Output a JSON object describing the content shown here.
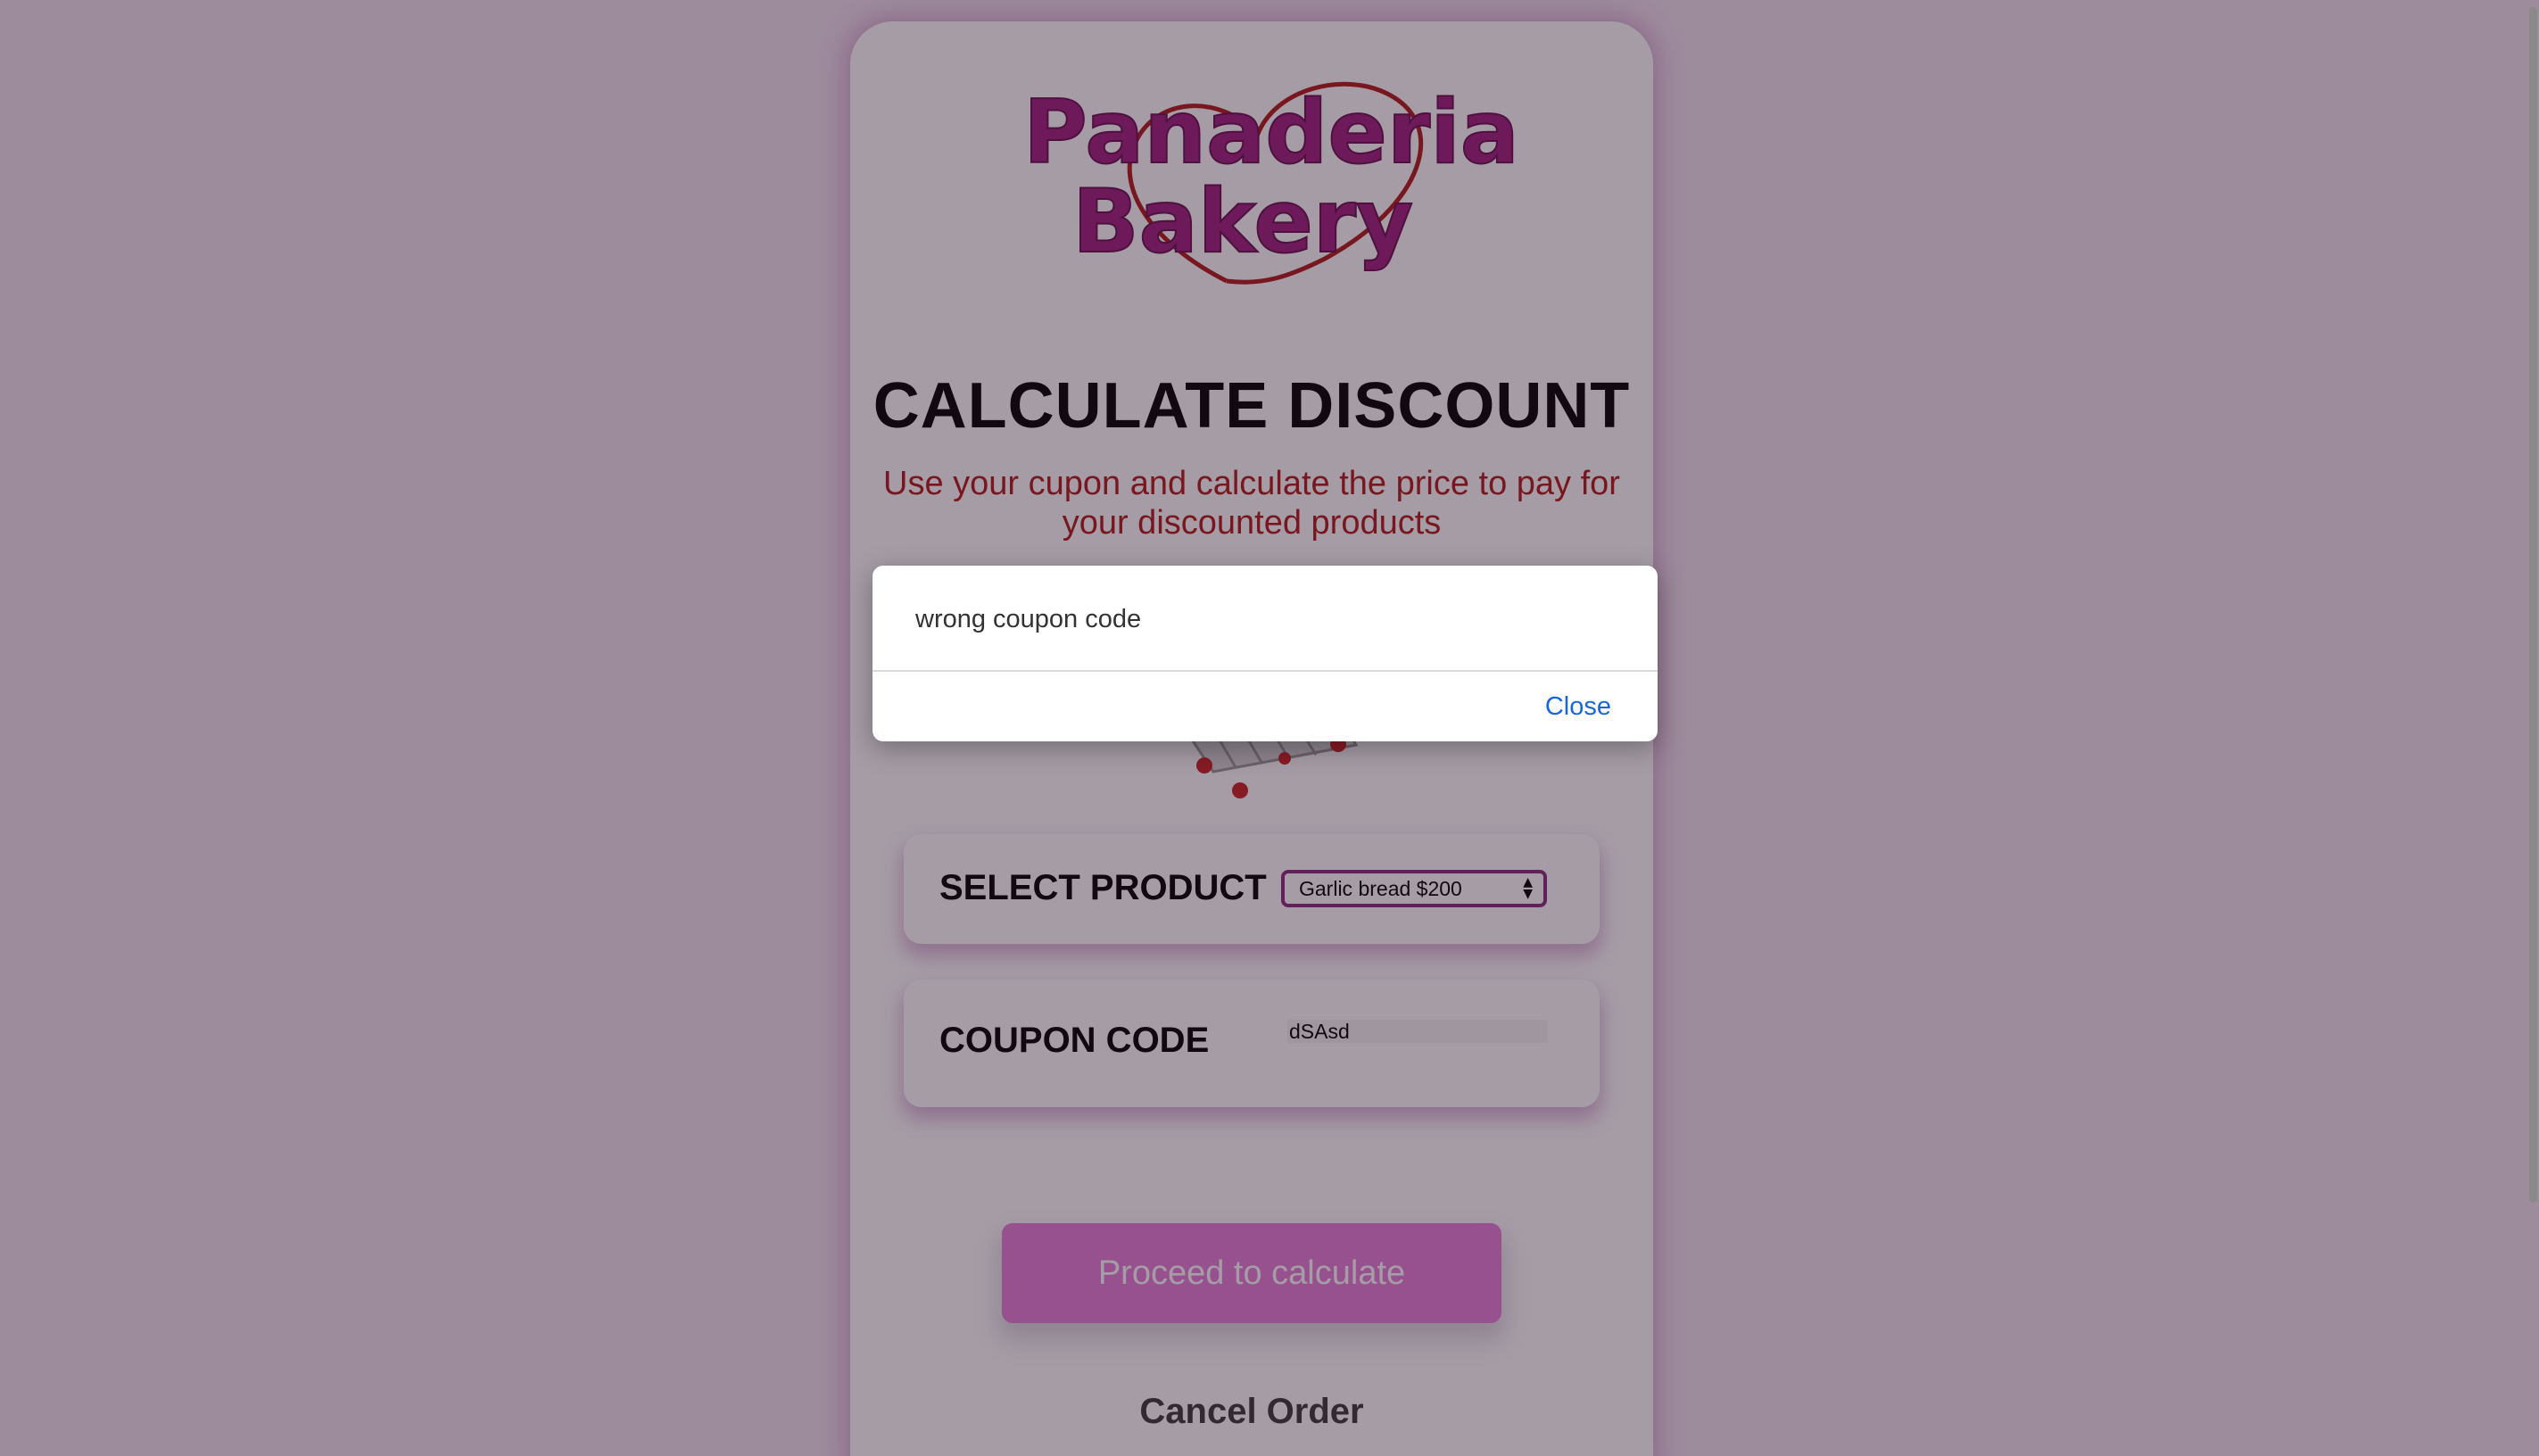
{
  "logo": {
    "line1": "Panaderia",
    "line2": "Bakery",
    "icon": "heart-outline-icon",
    "text_color": "#a0207f",
    "heart_color": "#b21a1a"
  },
  "page": {
    "title": "CALCULATE DISCOUNT",
    "subtitle": "Use your cupon and calculate the price to pay for your discounted products",
    "cart_icon": "shopping-cart-icon"
  },
  "form": {
    "product_label": "SELECT PRODUCT",
    "product_selected": "Garlic bread $200",
    "coupon_label": "COUPON CODE",
    "coupon_value": "dSAsd"
  },
  "actions": {
    "proceed_label": "Proceed to calculate",
    "cancel_label": "Cancel Order"
  },
  "dialog": {
    "message": "wrong coupon code",
    "close_label": "Close"
  },
  "colors": {
    "accent": "#e67fd8",
    "select_border": "#8a2a7f",
    "subtitle": "#b31a1a",
    "link": "#1a66d9"
  }
}
